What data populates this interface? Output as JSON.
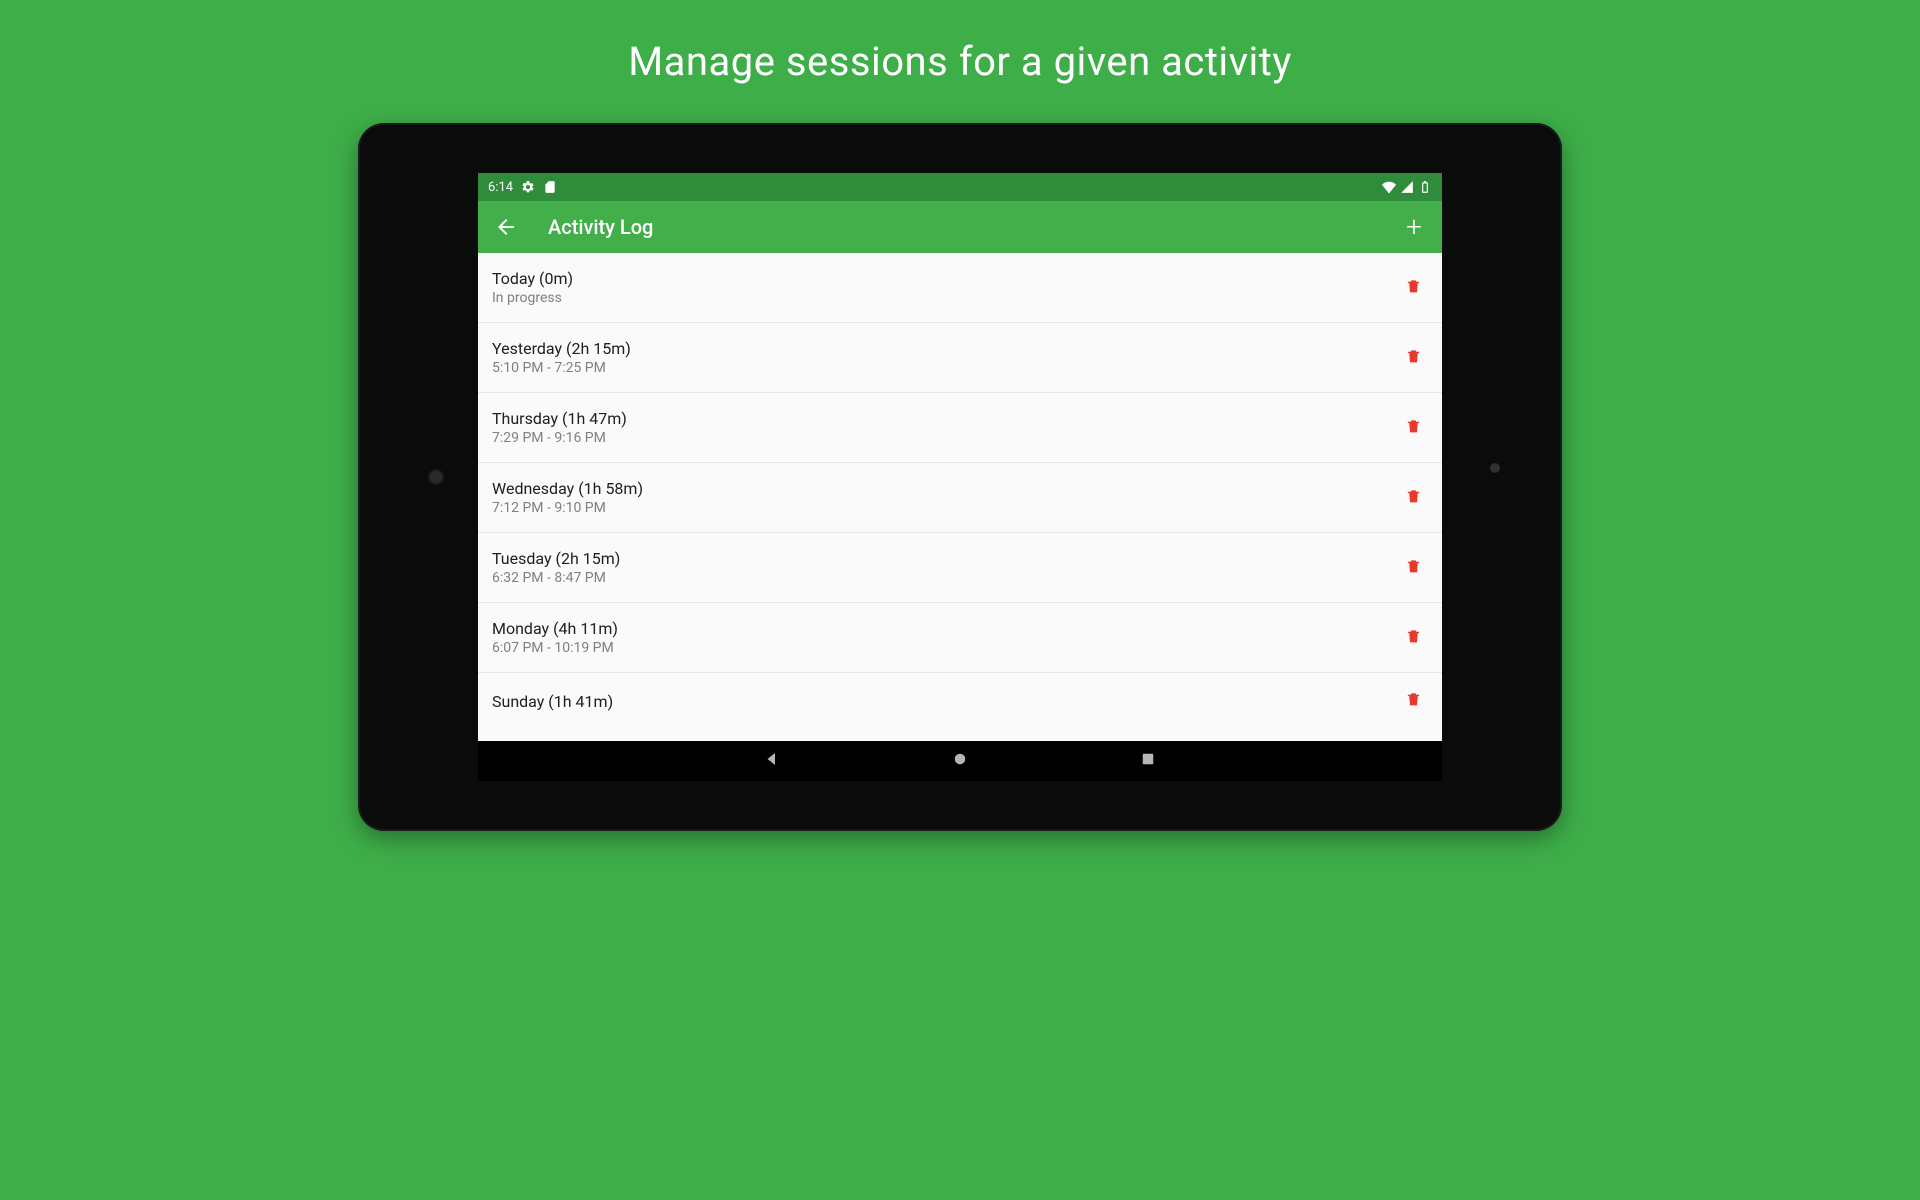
{
  "promo_title": "Manage sessions for a given activity",
  "statusbar": {
    "time": "6:14"
  },
  "appbar": {
    "title": "Activity Log"
  },
  "sessions": [
    {
      "title": "Today (0m)",
      "sub": "In progress"
    },
    {
      "title": "Yesterday (2h 15m)",
      "sub": "5:10 PM - 7:25 PM"
    },
    {
      "title": "Thursday (1h 47m)",
      "sub": "7:29 PM - 9:16 PM"
    },
    {
      "title": "Wednesday (1h 58m)",
      "sub": "7:12 PM - 9:10 PM"
    },
    {
      "title": "Tuesday (2h 15m)",
      "sub": "6:32 PM - 8:47 PM"
    },
    {
      "title": "Monday (4h 11m)",
      "sub": "6:07 PM - 10:19 PM"
    },
    {
      "title": "Sunday (1h 41m)",
      "sub": ""
    }
  ]
}
